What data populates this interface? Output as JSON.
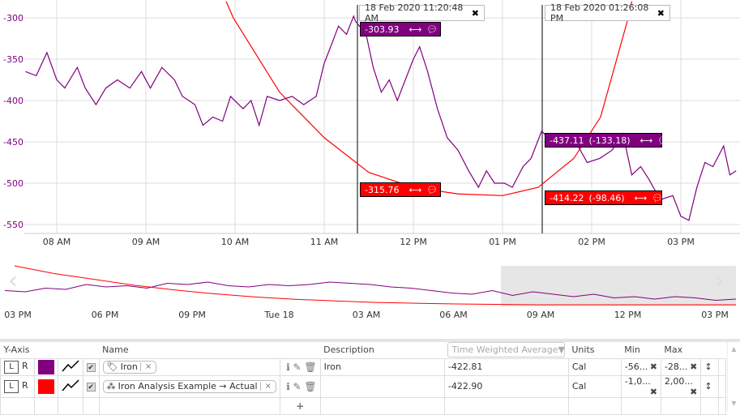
{
  "colors": {
    "iron": "#800080",
    "analysis": "#ff0000",
    "highlight": "#7dc832"
  },
  "y_axis": {
    "ticks": [
      -300,
      -350,
      -400,
      -450,
      -500,
      -550
    ],
    "range": [
      -550,
      -300
    ]
  },
  "x_axis": {
    "ticks": [
      {
        "h": 8,
        "label": "08 AM"
      },
      {
        "h": 9,
        "label": "09 AM"
      },
      {
        "h": 10,
        "label": "10 AM"
      },
      {
        "h": 11,
        "label": "11 AM"
      },
      {
        "h": 12,
        "label": "12 PM"
      },
      {
        "h": 13,
        "label": "01 PM"
      },
      {
        "h": 14,
        "label": "02 PM"
      },
      {
        "h": 15,
        "label": "03 PM"
      }
    ]
  },
  "chart_data": {
    "type": "line",
    "series": [
      {
        "name": "Iron",
        "points": [
          [
            7.65,
            -365
          ],
          [
            7.77,
            -370
          ],
          [
            7.89,
            -342
          ],
          [
            8.0,
            -375
          ],
          [
            8.09,
            -385
          ],
          [
            8.23,
            -360
          ],
          [
            8.32,
            -385
          ],
          [
            8.44,
            -405
          ],
          [
            8.55,
            -385
          ],
          [
            8.68,
            -375
          ],
          [
            8.82,
            -385
          ],
          [
            8.95,
            -365
          ],
          [
            9.05,
            -385
          ],
          [
            9.18,
            -360
          ],
          [
            9.32,
            -375
          ],
          [
            9.41,
            -395
          ],
          [
            9.55,
            -405
          ],
          [
            9.64,
            -430
          ],
          [
            9.75,
            -420
          ],
          [
            9.86,
            -425
          ],
          [
            9.95,
            -395
          ],
          [
            10.09,
            -410
          ],
          [
            10.18,
            -400
          ],
          [
            10.27,
            -430
          ],
          [
            10.36,
            -395
          ],
          [
            10.5,
            -400
          ],
          [
            10.64,
            -395
          ],
          [
            10.77,
            -405
          ],
          [
            10.91,
            -395
          ],
          [
            11.0,
            -355
          ],
          [
            11.09,
            -330
          ],
          [
            11.16,
            -310
          ],
          [
            11.25,
            -320
          ],
          [
            11.33,
            -298
          ],
          [
            11.35,
            -304
          ],
          [
            11.47,
            -320
          ],
          [
            11.55,
            -360
          ],
          [
            11.64,
            -390
          ],
          [
            11.73,
            -375
          ],
          [
            11.82,
            -400
          ],
          [
            11.91,
            -375
          ],
          [
            12.0,
            -350
          ],
          [
            12.07,
            -335
          ],
          [
            12.16,
            -365
          ],
          [
            12.27,
            -410
          ],
          [
            12.38,
            -445
          ],
          [
            12.5,
            -460
          ],
          [
            12.62,
            -485
          ],
          [
            12.73,
            -505
          ],
          [
            12.82,
            -485
          ],
          [
            12.91,
            -500
          ],
          [
            13.02,
            -500
          ],
          [
            13.11,
            -505
          ],
          [
            13.23,
            -480
          ],
          [
            13.32,
            -470
          ],
          [
            13.41,
            -445
          ],
          [
            13.44,
            -437
          ],
          [
            13.55,
            -450
          ],
          [
            13.68,
            -455
          ],
          [
            13.82,
            -450
          ],
          [
            13.95,
            -475
          ],
          [
            14.09,
            -470
          ],
          [
            14.23,
            -460
          ],
          [
            14.35,
            -440
          ],
          [
            14.45,
            -490
          ],
          [
            14.55,
            -480
          ],
          [
            14.64,
            -495
          ],
          [
            14.77,
            -520
          ],
          [
            14.91,
            -515
          ],
          [
            15.0,
            -540
          ],
          [
            15.09,
            -545
          ],
          [
            15.18,
            -505
          ],
          [
            15.27,
            -475
          ],
          [
            15.36,
            -480
          ],
          [
            15.48,
            -455
          ],
          [
            15.55,
            -490
          ],
          [
            15.62,
            -485
          ]
        ]
      },
      {
        "name": "Iron Analysis Example → Actual",
        "points": [
          [
            9.9,
            -280
          ],
          [
            9.98,
            -300
          ],
          [
            10.5,
            -390
          ],
          [
            11,
            -445
          ],
          [
            11.5,
            -487
          ],
          [
            12,
            -505
          ],
          [
            12.5,
            -513
          ],
          [
            13.0,
            -515
          ],
          [
            13.4,
            -505
          ],
          [
            13.8,
            -470
          ],
          [
            14.1,
            -420
          ],
          [
            14.41,
            -300
          ],
          [
            14.45,
            -280
          ]
        ]
      }
    ]
  },
  "navigator": {
    "labels": [
      "03 PM",
      "06 PM",
      "09 PM",
      "Tue 18",
      "03 AM",
      "06 AM",
      "09 AM",
      "12 PM",
      "03 PM"
    ],
    "iron": [
      0.45,
      0.5,
      0.35,
      0.4,
      0.2,
      0.3,
      0.25,
      0.35,
      0.15,
      0.2,
      0.1,
      0.25,
      0.3,
      0.2,
      0.25,
      0.2,
      0.1,
      0.15,
      0.2,
      0.3,
      0.35,
      0.45,
      0.55,
      0.6,
      0.45,
      0.65,
      0.5,
      0.6,
      0.7,
      0.6,
      0.75,
      0.7,
      0.8,
      0.7,
      0.75,
      0.85,
      0.8
    ],
    "analysis": [
      0,
      0.2,
      0.35,
      0.5,
      0.62,
      0.72,
      0.8,
      0.86,
      0.9,
      0.94,
      0.96,
      0.98,
      0.99,
      1,
      1,
      1,
      1,
      1,
      1
    ]
  },
  "cursors": [
    {
      "time": "18 Feb 2020 11:20:48 AM",
      "close": "✖"
    },
    {
      "time": "18 Feb 2020 01:26:08 PM",
      "close": "✖"
    }
  ],
  "flags": [
    {
      "value": "-303.93"
    },
    {
      "value": "-315.76"
    },
    {
      "value": "-437.11",
      "delta": "(-133.18)"
    },
    {
      "value": "-414.22",
      "delta": "(-98.46)"
    }
  ],
  "table": {
    "headers": {
      "yaxis": "Y-Axis",
      "name": "Name",
      "description": "Description",
      "aggregate": "Time Weighted Average",
      "units": "Units",
      "min": "Min",
      "max": "Max"
    },
    "rows": [
      {
        "l": "L",
        "r": "R",
        "name": "Iron",
        "description": "Iron",
        "value": "-422.81",
        "units": "Cal",
        "min": "-56...",
        "max": "-28..."
      },
      {
        "l": "L",
        "r": "R",
        "name": "Iron Analysis Example → Actual",
        "description": "",
        "value": "-422.90",
        "units": "Cal",
        "min": "-1,0...",
        "max": "2,00..."
      }
    ],
    "add": "+"
  }
}
